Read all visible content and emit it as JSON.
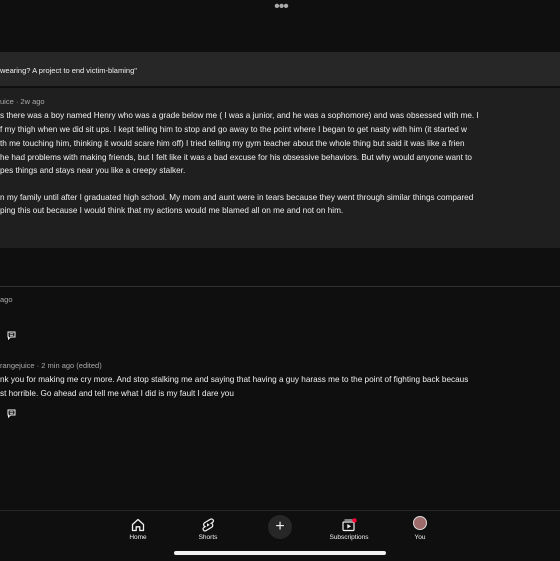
{
  "top_bar": {
    "more_icon": "more-horizontal-icon",
    "more_label": "•••"
  },
  "post": {
    "title": "wearing? A project to end victim-blaming\""
  },
  "comment_main": {
    "meta": "uice · 2w ago",
    "lines": [
      "s there was a boy named Henry who was a grade below me ( I was a junior, and he was a sophomore) and was obsessed with me. I",
      "f my thigh when we did sit ups. I kept telling him to stop and go away to the point where I began to get nasty with him (it started w",
      "th me touching him, thinking it would scare him off) I tried telling my gym teacher about the whole thing but said it was like a frien",
      " he had problems with making friends, but I felt like it was a bad excuse for his obsessive behaviors. But why would anyone want to",
      "pes things and stays near you like a creepy stalker.",
      "n my family until after I graduated high school. My mom and aunt were in tears because they went through similar things compared",
      "ping this out because I would think that my actions would me blamed all on me and not on him."
    ]
  },
  "reply_1": {
    "meta": "ago",
    "reply_icon": "reply-icon"
  },
  "reply_2": {
    "meta": "rangejuice · 2 min ago (edited)",
    "lines": [
      "nk you for making me cry more. And stop stalking me and saying that having a guy harass me to the point of fighting back becaus",
      "st horrible. Go ahead and tell me what I did is my fault I dare you"
    ],
    "reply_icon": "reply-icon"
  },
  "bottom_nav": {
    "items": [
      {
        "label": "Home",
        "icon": "home-icon"
      },
      {
        "label": "Shorts",
        "icon": "shorts-icon"
      },
      {
        "label": "",
        "icon": "create-plus-icon"
      },
      {
        "label": "Subscriptions",
        "icon": "subscriptions-icon"
      },
      {
        "label": "You",
        "icon": "avatar"
      }
    ]
  },
  "colors": {
    "background": "#0f0f0f",
    "card": "#1f1f1f",
    "title_bar": "#272727",
    "secondary_text": "#aaaaaa",
    "notification_dot": "#ff0033"
  }
}
